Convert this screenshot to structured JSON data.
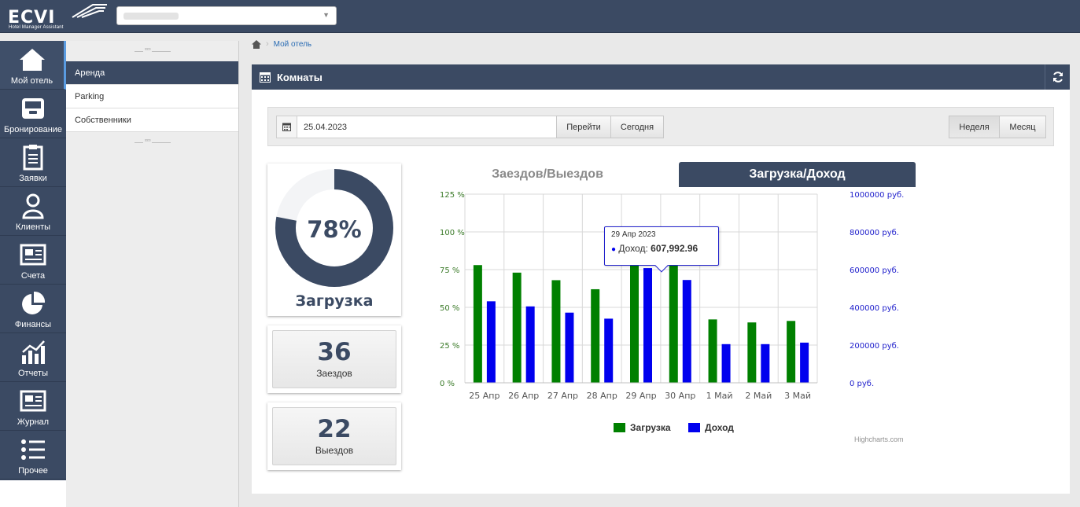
{
  "app": {
    "logo_text": "ECVI",
    "logo_subtitle": "Hotel Manager Assistant"
  },
  "nav": [
    {
      "label": "Мой отель",
      "icon": "home-icon"
    },
    {
      "label": "Бронирование",
      "icon": "inbox-icon"
    },
    {
      "label": "Заявки",
      "icon": "clipboard-icon"
    },
    {
      "label": "Клиенты",
      "icon": "user-icon"
    },
    {
      "label": "Счета",
      "icon": "invoice-icon"
    },
    {
      "label": "Финансы",
      "icon": "pie-chart-icon"
    },
    {
      "label": "Отчеты",
      "icon": "bar-chart-icon"
    },
    {
      "label": "Журнал",
      "icon": "journal-icon"
    },
    {
      "label": "Прочее",
      "icon": "list-icon"
    }
  ],
  "submenu": [
    {
      "label": "Аренда"
    },
    {
      "label": "Parking"
    },
    {
      "label": "Собственники"
    }
  ],
  "breadcrumb": {
    "current": "Мой отель"
  },
  "panel": {
    "title": "Комнаты"
  },
  "toolbar": {
    "date_value": "25.04.2023",
    "go_label": "Перейти",
    "today_label": "Сегодня",
    "week_label": "Неделя",
    "month_label": "Месяц"
  },
  "stats": {
    "occupancy_pct": "78%",
    "occupancy_fraction": 0.78,
    "occupancy_label": "Загрузка",
    "checkins_value": "36",
    "checkins_label": "Заездов",
    "checkouts_value": "22",
    "checkouts_label": "Выездов"
  },
  "chart_tabs": {
    "inactive": "Заездов/Выездов",
    "active": "Загрузка/Доход"
  },
  "tooltip": {
    "date": "29 Апр 2023",
    "series": "Доход:",
    "value": "607,992.96"
  },
  "colors": {
    "load": "#008000",
    "income": "#0000ee",
    "primary": "#3b4a63"
  },
  "credits": "Highcharts.com",
  "chart_data": {
    "type": "bar",
    "categories": [
      "25 Апр",
      "26 Апр",
      "27 Апр",
      "28 Апр",
      "29 Апр",
      "30 Апр",
      "1 Май",
      "2 Май",
      "3 Май"
    ],
    "series": [
      {
        "name": "Загрузка",
        "axis": "left",
        "values": [
          78,
          73,
          68,
          62,
          94,
          87,
          42,
          40,
          41
        ]
      },
      {
        "name": "Доход",
        "axis": "right",
        "values": [
          432000,
          405000,
          372000,
          340000,
          607992.96,
          545000,
          205000,
          205000,
          213000
        ]
      }
    ],
    "y_left": {
      "ylim": [
        0,
        125
      ],
      "ticks": [
        "0 %",
        "25 %",
        "50 %",
        "75 %",
        "100 %",
        "125 %"
      ]
    },
    "y_right": {
      "ylim": [
        0,
        1000000
      ],
      "ticks": [
        "0 руб.",
        "200000 руб.",
        "400000 руб.",
        "600000 руб.",
        "800000 руб.",
        "1000000 руб."
      ]
    },
    "grid": true,
    "legend": "bottom"
  }
}
